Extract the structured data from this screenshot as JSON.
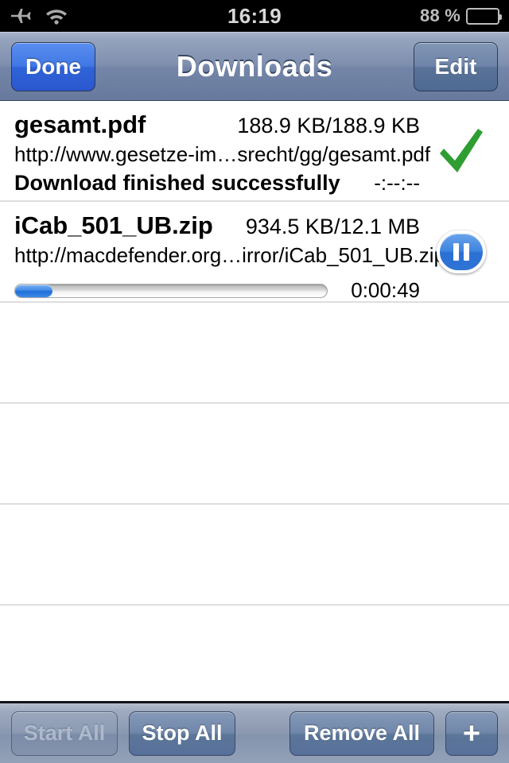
{
  "status_bar": {
    "airplane_icon": "airplane-icon",
    "wifi_icon": "wifi-icon",
    "time": "16:19",
    "battery_percent": "88 %",
    "battery_level": 88
  },
  "nav_bar": {
    "left_button": "Done",
    "title": "Downloads",
    "right_button": "Edit"
  },
  "downloads": [
    {
      "name": "gesamt.pdf",
      "size": "188.9 KB/188.9 KB",
      "url": "http://www.gesetze-im…srecht/gg/gesamt.pdf",
      "status": "Download finished successfully",
      "eta": "-:--:--",
      "accessory": "checkmark-icon",
      "accent_color": "#2f9e32"
    },
    {
      "name": "iCab_501_UB.zip",
      "size": "934.5 KB/12.1 MB",
      "url": "http://macdefender.org…irror/iCab_501_UB.zip",
      "progress_percent": 12,
      "eta": "0:00:49",
      "accessory": "pause-icon",
      "accent_color": "#3f84df"
    }
  ],
  "empty_rows": 4,
  "toolbar": {
    "start_all": "Start All",
    "start_all_enabled": false,
    "stop_all": "Stop All",
    "remove_all": "Remove All",
    "add": "+"
  }
}
